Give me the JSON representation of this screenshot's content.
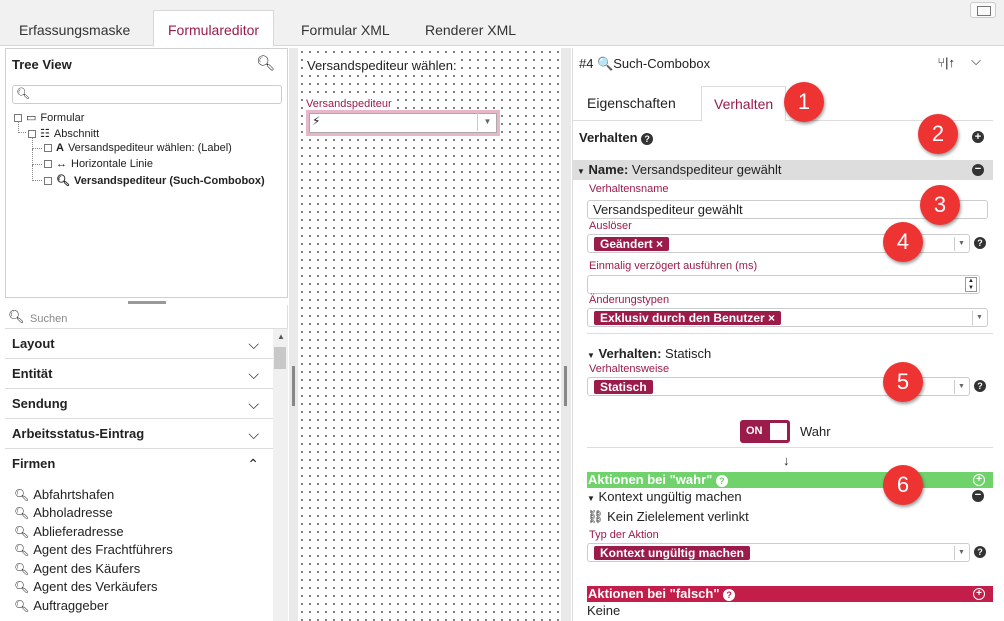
{
  "top_tabs": [
    "Erfassungsmaske",
    "Formulareditor",
    "Formular XML",
    "Renderer XML"
  ],
  "tree_view": {
    "title": "Tree View",
    "nodes": [
      {
        "label": "Formular"
      },
      {
        "label": "Abschnitt"
      },
      {
        "label": "Versandspediteur wählen: (Label)"
      },
      {
        "label": "Horizontale Linie"
      },
      {
        "label": "Versandspediteur (Such-Combobox)"
      }
    ]
  },
  "library": {
    "search_placeholder": "Suchen",
    "categories": [
      "Layout",
      "Entität",
      "Sendung",
      "Arbeitsstatus-Eintrag",
      "Firmen"
    ],
    "items": [
      "Abfahrtshafen",
      "Abholadresse",
      "Ablieferadresse",
      "Agent des Frachtführers",
      "Agent des Käufers",
      "Agent des Verkäufers",
      "Auftraggeber"
    ]
  },
  "canvas": {
    "label_text": "Versandspediteur wählen:",
    "combo_label": "Versandspediteur"
  },
  "props": {
    "title": "#4 🔍Such-Combobox",
    "tabs": [
      "Eigenschaften",
      "Verhalten"
    ],
    "section_title": "Verhalten",
    "name_bar_label": "Name:",
    "name_bar_value": "Versandspediteur gewählt",
    "fields": {
      "verhaltensname_label": "Verhaltensname",
      "verhaltensname_value": "Versandspediteur gewählt",
      "ausloeser_label": "Auslöser",
      "ausloeser_tag": "Geändert ×",
      "delay_label": "Einmalig verzögert ausführen (ms)",
      "aenderungstypen_label": "Änderungstypen",
      "aenderungstypen_tag": "Exklusiv durch den Benutzer ×",
      "verhalten_sub": "Verhalten:",
      "verhalten_sub_value": "Statisch",
      "verhaltensweise_label": "Verhaltensweise",
      "verhaltensweise_tag": "Statisch",
      "toggle_on": "ON",
      "toggle_text": "Wahr",
      "arrow_down": "↓"
    },
    "actions_true": {
      "title": "Aktionen bei \"wahr\"",
      "context_title": "Kontext ungültig machen",
      "no_target": "Kein Zielelement verlinkt",
      "type_label": "Typ der Aktion",
      "type_tag": "Kontext ungültig machen"
    },
    "actions_false": {
      "title": "Aktionen bei \"falsch\"",
      "value": "Keine"
    }
  },
  "callouts": [
    "1",
    "2",
    "3",
    "4",
    "5",
    "6"
  ],
  "colors": {
    "accent": "#9b1b4a",
    "true_bar": "#6fd26b",
    "false_bar": "#c31d4a",
    "callout": "#e33333"
  }
}
